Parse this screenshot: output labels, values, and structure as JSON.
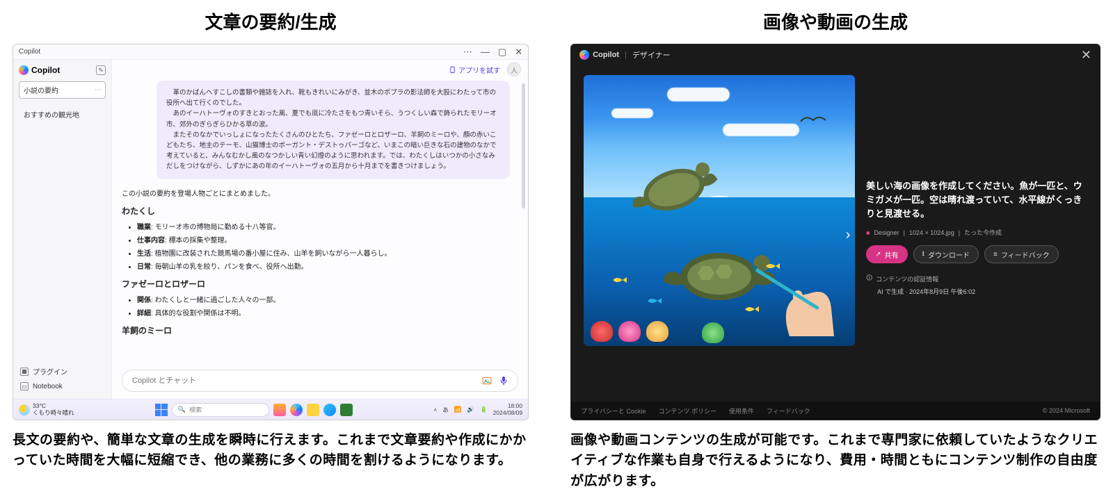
{
  "left": {
    "heading": "文章の要約/生成",
    "description": "長文の要約や、簡単な文章の生成を瞬時に行えます。これまで文章要約や作成にかかっていた時間を大幅に短縮でき、他の業務に多くの時間を割けるようになります。",
    "copilot": {
      "window_title": "Copilot",
      "brand": "Copilot",
      "try_app": "アプリを試す",
      "sidebar": {
        "items": [
          {
            "label": "小説の要約",
            "active": true
          },
          {
            "label": "おすすめの観光地",
            "active": false
          }
        ],
        "footer": [
          {
            "label": "プラグイン"
          },
          {
            "label": "Notebook"
          }
        ]
      },
      "context_paragraphs": [
        "革のかばんへすこしの書類や雑誌を入れ、靴もきれいにみがき、並木のポプラの影法師を大股にわたって市の役所へ出て行くのでした。",
        "あのイーハトーヴォのすきとおった風、夏でも底に冷たさをもつ青いそら、うつくしい森で飾られたモリーオ市、郊外のぎらぎらひかる草の波。",
        "またそのなかでいっしょになったたくさんのひとたち、ファゼーロとロザーロ、羊飼のミーロや、顔の赤いこどもたち、地主のテーモ、山猫博士のボーガント・デストゥパーゴなど、いまこの暗い巨きな石の建物のなかで考えていると、みんなむかし風のなつかしい青い幻燈のように思われます。では、わたくしはいつかの小さなみだしをつけながら、しずかにあの年のイーハトーヴォの五月から十月までを書きつけましょう。"
      ],
      "summary": {
        "lead": "この小説の要約を登場人物ごとにまとめました。",
        "sections": [
          {
            "title": "わたくし",
            "bullets": [
              {
                "k": "職業",
                "v": "モリーオ市の博物局に勤める十八等官。"
              },
              {
                "k": "仕事内容",
                "v": "標本の採集や整理。"
              },
              {
                "k": "生活",
                "v": "植物園に改装された競馬場の番小屋に住み、山羊を飼いながら一人暮らし。"
              },
              {
                "k": "日常",
                "v": "毎朝山羊の乳を絞り、パンを食べ、役所へ出勤。"
              }
            ]
          },
          {
            "title": "ファゼーロとロザーロ",
            "bullets": [
              {
                "k": "関係",
                "v": "わたくしと一緒に過ごした人々の一部。"
              },
              {
                "k": "詳細",
                "v": "具体的な役割や関係は不明。"
              }
            ]
          },
          {
            "title": "羊飼のミーロ",
            "bullets": []
          }
        ]
      },
      "composer_placeholder": "Copilot とチャット"
    },
    "taskbar": {
      "weather_temp": "33°C",
      "weather_label": "くもり時々晴れ",
      "search_placeholder": "検索",
      "ime": "あ",
      "time": "18:00",
      "date": "2024/08/09"
    }
  },
  "right": {
    "heading": "画像や動画の生成",
    "description": "画像や動画コンテンツの生成が可能です。これまで専門家に依頼していたようなクリエイティブな作業も自身で行えるようになり、費用・時間ともにコンテンツ制作の自由度が広がります。",
    "designer": {
      "brand": "Copilot",
      "mode": "デザイナー",
      "prompt": "美しい海の画像を作成してください。魚が一匹と、ウミガメが一匹。空は晴れ渡っていて、水平線がくっきりと見渡せる。",
      "meta": {
        "source": "Designer",
        "size": "1024 × 1024.jpg",
        "created": "たった今作成"
      },
      "actions": {
        "share": "共有",
        "download": "ダウンロード",
        "feedback": "フィードバック"
      },
      "credentials": {
        "label": "コンテンツの認証情報",
        "value": "AI で生成 · 2024年8月9日 午後6:02"
      },
      "footer": {
        "privacy": "プライバシーと Cookie",
        "policy": "コンテンツ ポリシー",
        "terms": "使用条件",
        "feedback": "フィードバック",
        "copyright": "© 2024 Microsoft"
      }
    }
  }
}
